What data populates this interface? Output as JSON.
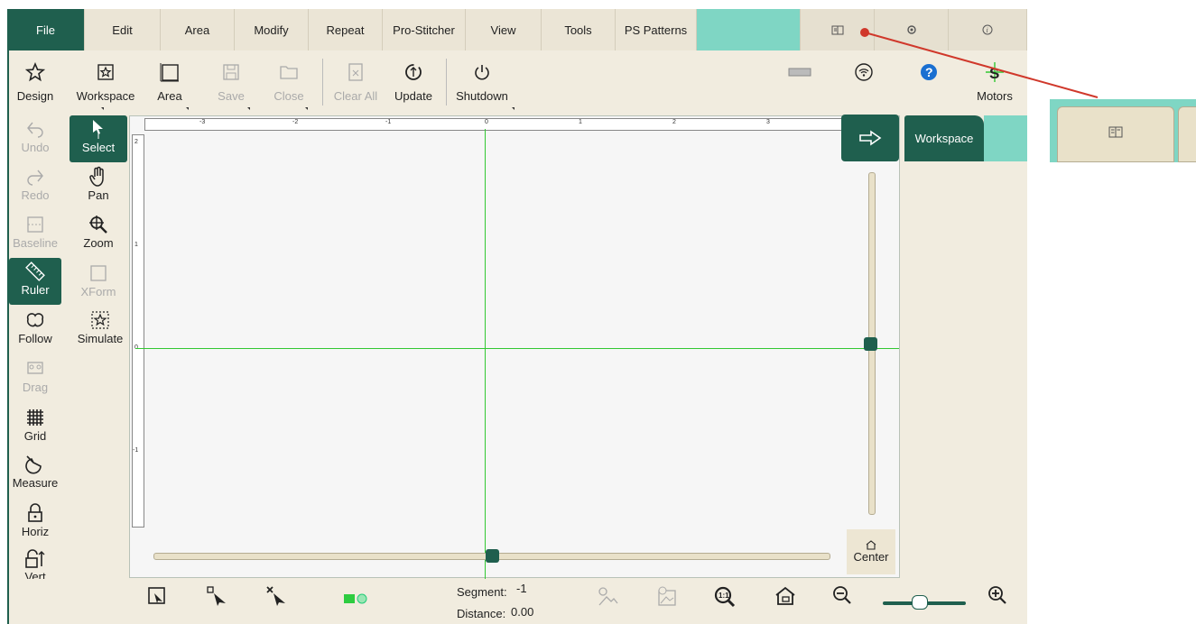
{
  "menu": {
    "items": [
      "File",
      "Edit",
      "Area",
      "Modify",
      "Repeat",
      "Pro-Stitcher",
      "View",
      "Tools",
      "PS Patterns"
    ],
    "active": "File",
    "right_icons": [
      "book-icon",
      "gear-icon",
      "info-icon"
    ]
  },
  "toolbar": {
    "design": "Design",
    "workspace": "Workspace",
    "area": "Area",
    "save": "Save",
    "close": "Close",
    "clear_all": "Clear All",
    "update": "Update",
    "shutdown": "Shutdown",
    "motors": "Motors"
  },
  "left_tools": {
    "undo": "Undo",
    "redo": "Redo",
    "baseline": "Baseline",
    "ruler": "Ruler",
    "follow": "Follow",
    "drag": "Drag",
    "grid": "Grid",
    "measure": "Measure",
    "horiz": "Horiz",
    "vert": "Vert",
    "select": "Select",
    "pan": "Pan",
    "zoom": "Zoom",
    "xform": "XForm",
    "simulate": "Simulate"
  },
  "ruler": {
    "h_ticks": [
      "-3",
      "-2",
      "-1",
      "0",
      "1",
      "2",
      "3"
    ],
    "v_ticks": [
      "2",
      "1",
      "0",
      "-1"
    ]
  },
  "canvas": {
    "center_label": "Center"
  },
  "side": {
    "workspace_tab": "Workspace"
  },
  "status": {
    "segment_label": "Segment:",
    "segment_value": "-1",
    "distance_label": "Distance:",
    "distance_value": "0.00"
  },
  "colors": {
    "accent": "#1f5f4e",
    "teal": "#7fd6c4",
    "guide": "#32c832",
    "callout_arrow": "#d0382b"
  }
}
